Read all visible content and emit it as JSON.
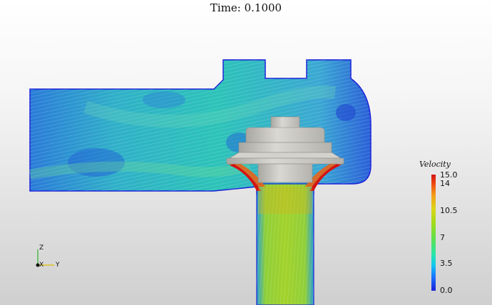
{
  "title": {
    "time_label": "Time: 0.1000"
  },
  "colorbar": {
    "title": "Velocity",
    "ticks": [
      "15.0",
      "14",
      "10.5",
      "7",
      "3.5",
      "0.0"
    ],
    "min": 0.0,
    "max": 15.0
  },
  "axes": {
    "z": "Z",
    "x": "X",
    "y": "Y"
  },
  "colors": {
    "flow_low": "#1b21d8",
    "flow_mid": "#1fb6c8",
    "flow_high": "#d21413",
    "valve_gray": "#c8c6c0"
  }
}
